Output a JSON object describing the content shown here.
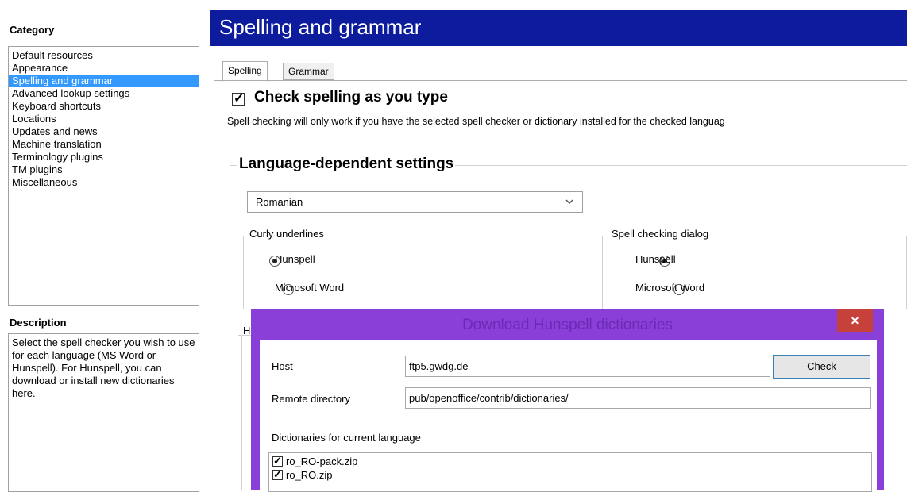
{
  "sidebar": {
    "category_title": "Category",
    "items": [
      {
        "label": "Default resources"
      },
      {
        "label": "Appearance"
      },
      {
        "label": "Spelling and grammar",
        "selected": true
      },
      {
        "label": "Advanced lookup settings"
      },
      {
        "label": "Keyboard shortcuts"
      },
      {
        "label": "Locations"
      },
      {
        "label": "Updates and news"
      },
      {
        "label": "Machine translation"
      },
      {
        "label": "Terminology plugins"
      },
      {
        "label": "TM plugins"
      },
      {
        "label": "Miscellaneous"
      }
    ],
    "description_title": "Description",
    "description_text": "Select the spell checker you wish to use for each language (MS Word or Hunspell). For Hunspell, you can download or install new dictionaries here."
  },
  "header": {
    "title": "Spelling and grammar"
  },
  "tabs": [
    {
      "label": "Spelling",
      "active": true
    },
    {
      "label": "Grammar",
      "active": false
    }
  ],
  "spelling": {
    "check_label": "Check spelling as you type",
    "check_checked": true,
    "note": "Spell checking will only work if you have the selected spell checker or dictionary installed for the checked languag"
  },
  "language_settings": {
    "title": "Language-dependent settings",
    "language_value": "Romanian",
    "curly": {
      "title": "Curly underlines",
      "options": [
        {
          "label": "Hunspell",
          "selected": true
        },
        {
          "label": "Microsoft Word",
          "selected": false
        }
      ]
    },
    "dialog_check": {
      "title": "Spell checking dialog",
      "options": [
        {
          "label": "Hunspell",
          "selected": true
        },
        {
          "label": "Microsoft Word",
          "selected": false
        }
      ]
    },
    "hidden_group_initial": "H"
  },
  "download_dialog": {
    "title": "Download Hunspell dictionaries",
    "close_glyph": "✕",
    "host_label": "Host",
    "host_value": "ftp5.gwdg.de",
    "check_button": "Check",
    "remote_label": "Remote directory",
    "remote_value": "pub/openoffice/contrib/dictionaries/",
    "dict_label": "Dictionaries for current language",
    "dictionaries": [
      {
        "name": "ro_RO-pack.zip",
        "checked": true
      },
      {
        "name": "ro_RO.zip",
        "checked": true
      }
    ]
  },
  "colors": {
    "header_bg": "#0c1c9c",
    "selection": "#3399ff",
    "dialog_frame": "#8a3fd8",
    "close_button": "#c7413b"
  }
}
